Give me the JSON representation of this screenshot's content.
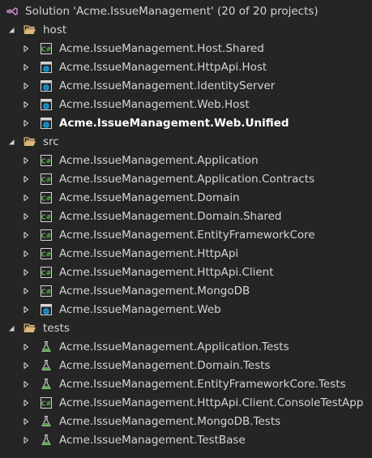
{
  "solution": {
    "label": "Solution 'Acme.IssueManagement' (20 of 20 projects)",
    "icon": "visual-studio-solution-icon"
  },
  "folders": [
    {
      "name": "host",
      "expanded": true,
      "projects": [
        {
          "name": "Acme.IssueManagement.Host.Shared",
          "icon": "csharp-project-icon"
        },
        {
          "name": "Acme.IssueManagement.HttpApi.Host",
          "icon": "web-project-icon"
        },
        {
          "name": "Acme.IssueManagement.IdentityServer",
          "icon": "web-project-icon"
        },
        {
          "name": "Acme.IssueManagement.Web.Host",
          "icon": "web-project-icon"
        },
        {
          "name": "Acme.IssueManagement.Web.Unified",
          "icon": "web-project-icon",
          "selected": true
        }
      ]
    },
    {
      "name": "src",
      "expanded": true,
      "projects": [
        {
          "name": "Acme.IssueManagement.Application",
          "icon": "csharp-project-icon"
        },
        {
          "name": "Acme.IssueManagement.Application.Contracts",
          "icon": "csharp-project-icon"
        },
        {
          "name": "Acme.IssueManagement.Domain",
          "icon": "csharp-project-icon"
        },
        {
          "name": "Acme.IssueManagement.Domain.Shared",
          "icon": "csharp-project-icon"
        },
        {
          "name": "Acme.IssueManagement.EntityFrameworkCore",
          "icon": "csharp-project-icon"
        },
        {
          "name": "Acme.IssueManagement.HttpApi",
          "icon": "csharp-project-icon"
        },
        {
          "name": "Acme.IssueManagement.HttpApi.Client",
          "icon": "csharp-project-icon"
        },
        {
          "name": "Acme.IssueManagement.MongoDB",
          "icon": "csharp-project-icon"
        },
        {
          "name": "Acme.IssueManagement.Web",
          "icon": "web-project-icon"
        }
      ]
    },
    {
      "name": "tests",
      "expanded": true,
      "projects": [
        {
          "name": "Acme.IssueManagement.Application.Tests",
          "icon": "test-project-icon"
        },
        {
          "name": "Acme.IssueManagement.Domain.Tests",
          "icon": "test-project-icon"
        },
        {
          "name": "Acme.IssueManagement.EntityFrameworkCore.Tests",
          "icon": "test-project-icon"
        },
        {
          "name": "Acme.IssueManagement.HttpApi.Client.ConsoleTestApp",
          "icon": "csharp-project-icon"
        },
        {
          "name": "Acme.IssueManagement.MongoDB.Tests",
          "icon": "test-project-icon"
        },
        {
          "name": "Acme.IssueManagement.TestBase",
          "icon": "test-project-icon"
        }
      ]
    }
  ],
  "colors": {
    "background": "#252526",
    "text": "#d4d4d4",
    "selected_text": "#ffffff",
    "folder": "#dcb67a",
    "csharp_green": "#388a34",
    "web_blue": "#1ba1e2",
    "solution_purple": "#c586c0"
  }
}
